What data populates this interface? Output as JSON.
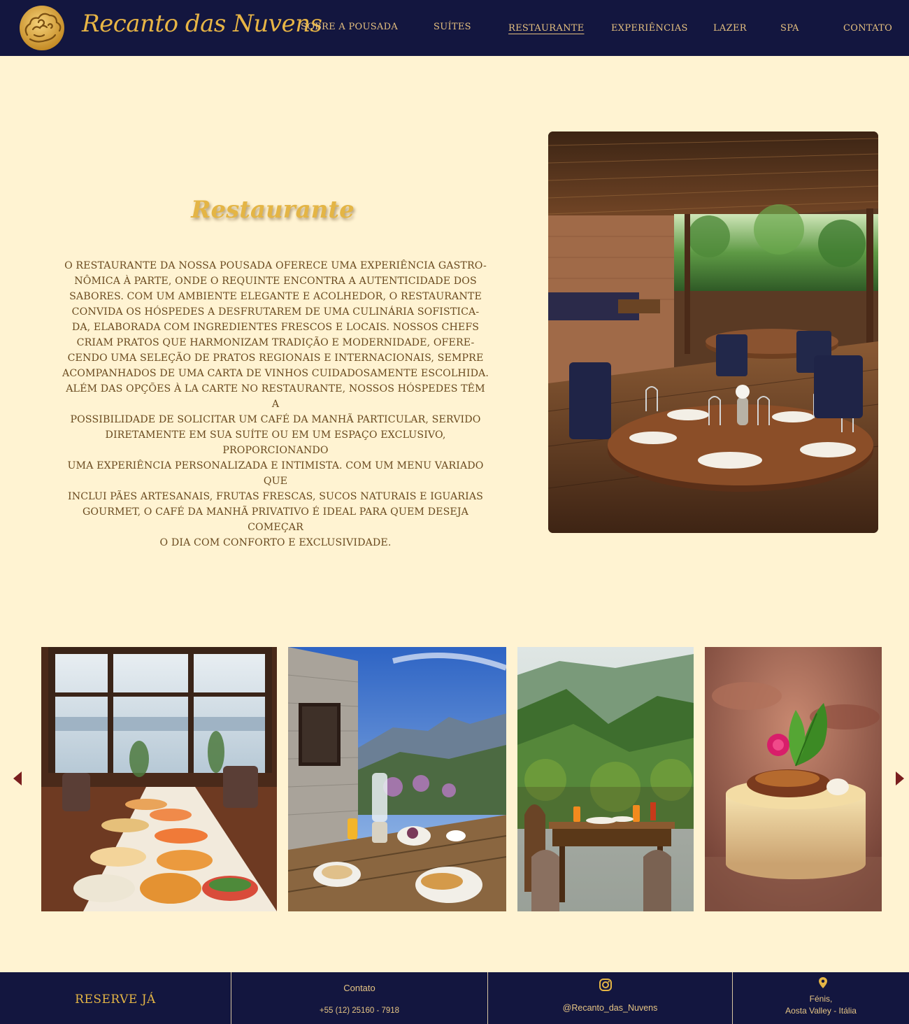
{
  "brand": {
    "name": "Recanto das Nuvens",
    "logo_icon": "cloud-ornament-icon"
  },
  "nav": {
    "items": [
      {
        "label": "Sobre a Pousada"
      },
      {
        "label": "Suítes"
      },
      {
        "label": "Restaurante",
        "active": true
      },
      {
        "label": "Experiências"
      },
      {
        "label": "Lazer"
      },
      {
        "label": "Spa"
      },
      {
        "label": "Contato"
      }
    ]
  },
  "restaurant": {
    "title": "Restaurante",
    "lines": [
      "O restaurante da nossa pousada oferece uma experiência gastro-",
      "nômica à parte, onde o requinte encontra a autenticidade dos",
      "sabores. Com um ambiente  elegante e acolhedor, o restaurante",
      "convida os hóspedes a desfrutarem de uma culinária sofistica-",
      "da, elaborada com ingredientes frescos e locais. Nossos chefs",
      "criam pratos que harmonizam tradição e modernidade, ofere-",
      "cendo uma seleção de pratos regionais e internacionais, sempre",
      "acompanhados de uma carta de vinhos cuidadosamente escolhida.",
      "Além das opções à la carte no restaurante, nossos hóspedes têm a",
      "possibilidade de solicitar um café da manhã particular, servido",
      "diretamente em sua suíte ou em um espaço exclusivo, proporcionando",
      "uma experiência  personalizada e intimista. Com um menu variado que",
      "inclui pães artesanais, frutas frescas, sucos naturais e iguarias",
      "gourmet, o café da manhã privativo é ideal para quem deseja começar",
      "o dia com conforto e exclusividade."
    ]
  },
  "carousel": {
    "prev_icon": "arrow-left-icon",
    "next_icon": "arrow-right-icon"
  },
  "footer": {
    "reserve_label": "Reserve já",
    "contact_label": "Contato",
    "phone": "+55 (12) 25160 - 7918",
    "instagram_icon": "instagram-icon",
    "instagram_handle": "@Recanto_das_Nuvens",
    "location_icon": "map-pin-icon",
    "location_line1": "Fénis,",
    "location_line2": "Aosta Valley -  Itália"
  },
  "colors": {
    "navy": "#13163f",
    "cream": "#fff3d2",
    "gold": "#e4b545",
    "brown_text": "#6a4a1f",
    "arrow": "#7a1e1e"
  }
}
